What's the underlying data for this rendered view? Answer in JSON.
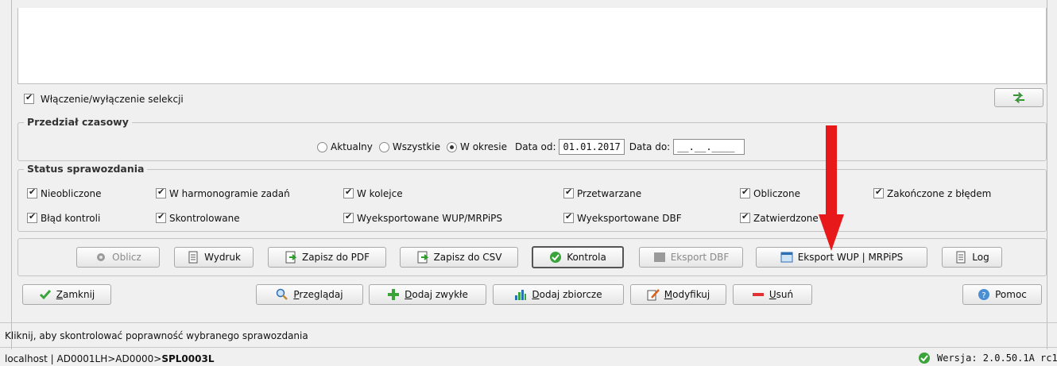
{
  "selection": {
    "toggle_label": "Włączenie/wyłączenie selekcji"
  },
  "time_range": {
    "title": "Przedział czasowy",
    "options": [
      "Aktualny",
      "Wszystkie",
      "W okresie"
    ],
    "selected": "W okresie",
    "date_from_label": "Data od:",
    "date_from": "01.01.2017",
    "date_to_label": "Data do:",
    "date_to": "__.__.____"
  },
  "status": {
    "title": "Status sprawozdania",
    "row1": [
      "Nieobliczone",
      "W harmonogramie zadań",
      "W kolejce",
      "Przetwarzane",
      "Obliczone",
      "Zakończone z błędem"
    ],
    "row2": [
      "Błąd kontroli",
      "Skontrolowane",
      "Wyeksportowane WUP/MRPiPS",
      "Wyeksportowane DBF",
      "Zatwierdzone"
    ]
  },
  "actions": {
    "oblicz": "Oblicz",
    "wydruk": "Wydruk",
    "pdf": "Zapisz do PDF",
    "csv": "Zapisz do CSV",
    "kontrola": "Kontrola",
    "dbf": "Eksport DBF",
    "wup": "Eksport WUP | MRPiPS",
    "log": "Log"
  },
  "nav": {
    "zamknij_first": "Z",
    "zamknij_rest": "amknij",
    "przegladaj_first": "P",
    "przegladaj_rest": "rzeglądaj",
    "dodaj_zwykle_first": "D",
    "dodaj_zwykle_rest": "odaj zwykłe",
    "dodaj_zbiorcze_first": "D",
    "dodaj_zbiorcze_rest": "odaj zbiorcze",
    "modyfikuj_first": "M",
    "modyfikuj_rest": "odyfikuj",
    "usun_first": "U",
    "usun_rest": "suń",
    "pomoc": "Pomoc"
  },
  "statusbar": {
    "hint": "Kliknij, aby skontrolować poprawność wybranego sprawozdania",
    "connection_prefix": "localhost | AD0001LH>AD0000>",
    "connection_bold": "SPL0003L",
    "version": "Wersja: 2.0.50.1A rc1"
  },
  "colors": {
    "annotation_arrow": "#e8191a",
    "accent_green": "#3aa33a"
  }
}
